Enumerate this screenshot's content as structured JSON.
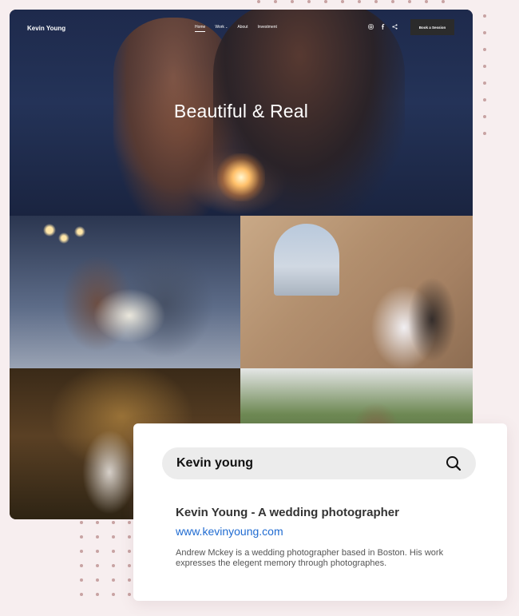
{
  "site": {
    "brand": "Kevin Young",
    "nav": [
      {
        "label": "Home",
        "active": true
      },
      {
        "label": "Work",
        "dropdown": true
      },
      {
        "label": "About"
      },
      {
        "label": "Investment"
      }
    ],
    "socials": [
      "instagram-icon",
      "facebook-icon",
      "share-icon"
    ],
    "cta_label": "Book a Session",
    "hero_title": "Beautiful & Real",
    "gallery": [
      "photo-couple-kiss-bouquet",
      "photo-couple-stone-window",
      "photo-couple-forest-dance",
      "photo-sunflowers-bride"
    ]
  },
  "search": {
    "query": "Kevin young",
    "icon": "search-icon"
  },
  "result": {
    "title": "Kevin Young - A wedding photographer",
    "url": "www.kevinyoung.com",
    "description": "Andrew Mckey is a wedding photographer based in Boston. His work expresses the elegent memory through photographes."
  },
  "colors": {
    "background": "#f7eeef",
    "link": "#1f6bd1",
    "cta": "#2b2b2b",
    "dots": "#c8a3a3"
  }
}
